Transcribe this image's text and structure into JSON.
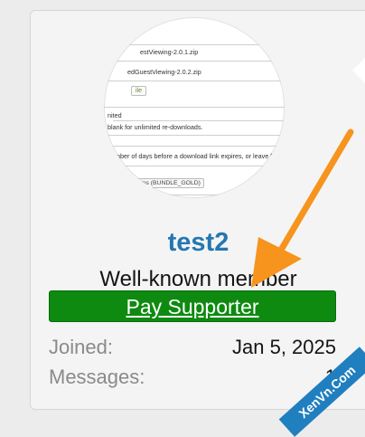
{
  "avatar": {
    "snippet_lines": [
      "estViewing-2.0.1.zip",
      "edGuestViewing-2.0.2.zip",
      "ile",
      "nited",
      "blank for unlimited re-downloads.",
      "",
      "number of days before a download link expires, or leave bl",
      "ships (BUNDLE_GOLD)"
    ]
  },
  "profile": {
    "username": "test2",
    "user_title": "Well-known member",
    "banner": "Pay Supporter",
    "stats": [
      {
        "label": "Joined:",
        "value": "Jan 5, 2025"
      },
      {
        "label": "Messages:",
        "value": "1"
      }
    ]
  },
  "colors": {
    "username": "#2577b1",
    "banner_bg": "#0e8a10",
    "arrow": "#f7941d"
  },
  "watermark": "XenVn.Com"
}
